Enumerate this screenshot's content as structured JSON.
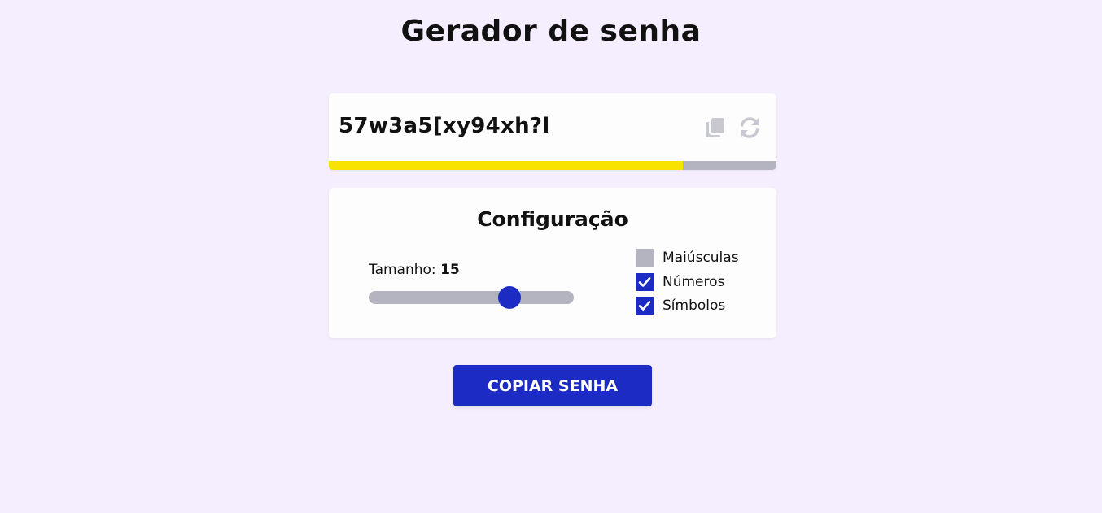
{
  "title": "Gerador de senha",
  "password": {
    "value": "57w3a5[xy94xh?l",
    "strength_percent": 79,
    "strength_color": "#f7e200",
    "track_color": "#b4b4c0",
    "actions": [
      {
        "icon": "copy-icon"
      },
      {
        "icon": "refresh-icon"
      }
    ]
  },
  "config": {
    "title": "Configuração",
    "length": {
      "label": "Tamanho:",
      "value": "15",
      "min": 4,
      "max": 20
    },
    "options": [
      {
        "label": "Maiúsculas",
        "checked": false
      },
      {
        "label": "Números",
        "checked": true
      },
      {
        "label": "Símbolos",
        "checked": true
      }
    ]
  },
  "copy_button_label": "COPIAR SENHA",
  "colors": {
    "background": "#f5eeff",
    "accent": "#1c2bc4",
    "inactive": "#b4b4c0"
  }
}
